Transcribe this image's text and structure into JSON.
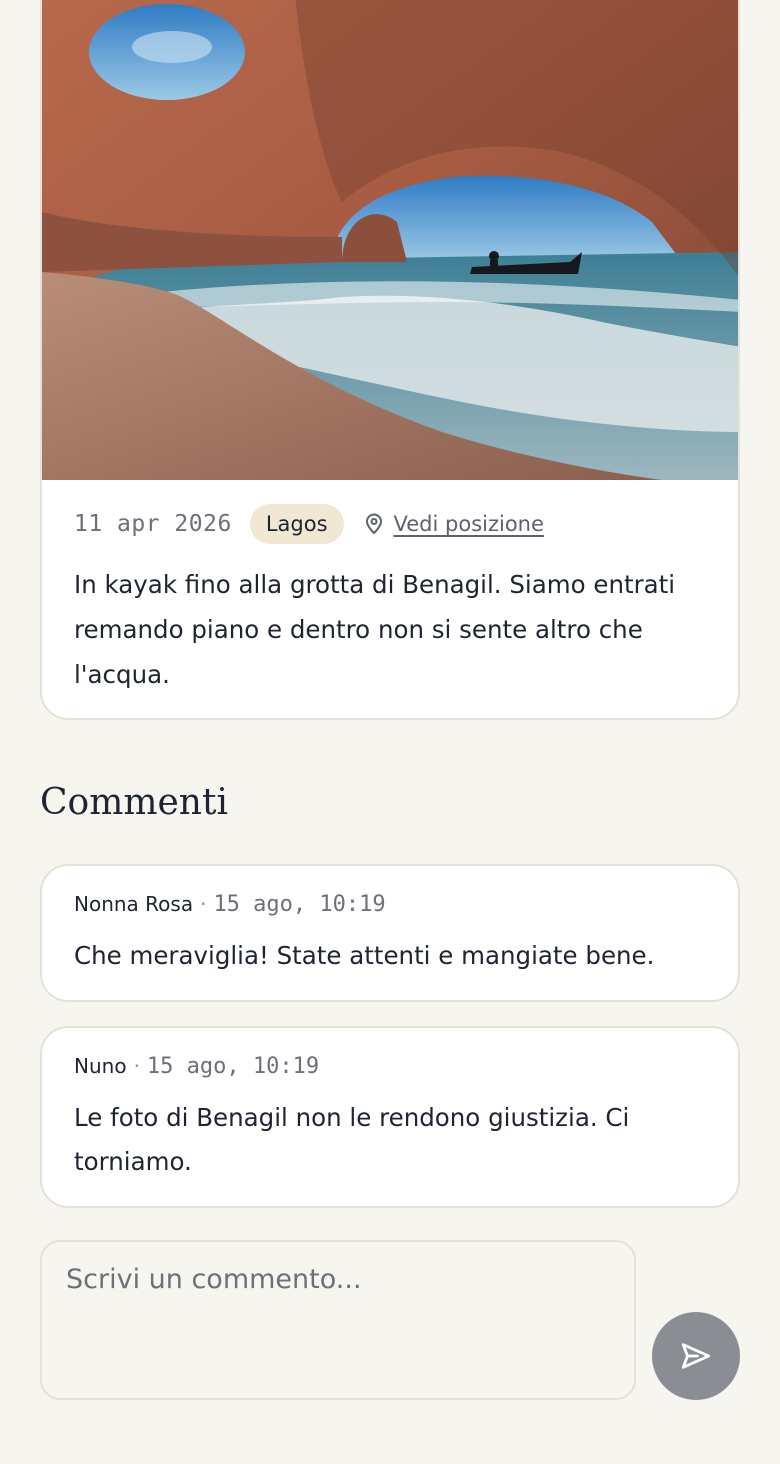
{
  "post": {
    "date": "11 apr 2026",
    "location": "Lagos",
    "map_link_label": "Vedi posizione",
    "text": "In kayak fino alla grotta di Benagil. Siamo entrati remando piano e dentro non si sente altro che l'acqua."
  },
  "comments_section": {
    "title": "Commenti",
    "comments": [
      {
        "author": "Nonna Rosa",
        "separator": "·",
        "time": "15 ago, 10:19",
        "text": "Che meraviglia! State attenti e mangiate bene."
      },
      {
        "author": "Nuno",
        "separator": "·",
        "time": "15 ago, 10:19",
        "text": "Le foto di Benagil non le rendono giustizia. Ci torniamo."
      }
    ]
  },
  "composer": {
    "placeholder": "Scrivi un commento...",
    "send_icon": "send-icon"
  },
  "colors": {
    "background": "#f7f5f0",
    "card": "#ffffff",
    "border": "#e4e1d6",
    "badge": "#f1e8d4",
    "send_button": "#8b8d95"
  }
}
